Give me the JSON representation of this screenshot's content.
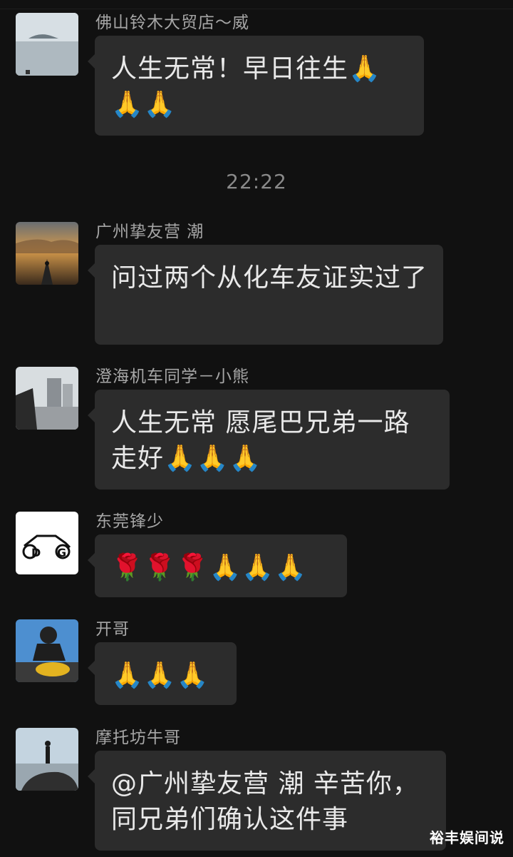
{
  "time_divider": "22:22",
  "watermark": "裕丰娱间说",
  "messages": [
    {
      "sender": "佛山铃木大贸店～威",
      "text": "人生无常！早日往生🙏🙏🙏",
      "avatar": "sea-island-avatar"
    },
    {
      "sender": "广州挚友营 潮",
      "text": "问过两个从化车友证实过了",
      "avatar": "motorcycle-road-avatar"
    },
    {
      "sender": "澄海机车同学－小熊",
      "text": "人生无常 愿尾巴兄弟一路走好🙏🙏🙏",
      "avatar": "street-view-avatar"
    },
    {
      "sender": "东莞锋少",
      "text": "🌹🌹🌹🙏🙏🙏",
      "avatar": "dg-motorcycle-logo-avatar"
    },
    {
      "sender": "开哥",
      "text": "🙏🙏🙏",
      "avatar": "rider-helmet-avatar"
    },
    {
      "sender": "摩托坊牛哥",
      "text": "@广州挚友营 潮 辛苦你，同兄弟们确认这件事",
      "avatar": "man-on-car-avatar"
    }
  ]
}
